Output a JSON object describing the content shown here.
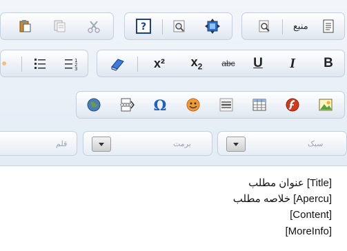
{
  "toolbar": {
    "source_label": "منبع",
    "superscript": "x²",
    "subscript_base": "x",
    "subscript_index": "2",
    "strike": "abc",
    "underline": "U",
    "italic": "I",
    "bold": "B"
  },
  "combos": {
    "style_placeholder": "سبک",
    "format_placeholder": "برمت",
    "font_placeholder": "قلم"
  },
  "content": {
    "lines": [
      "عنوان مطلب [Title]",
      "خلاصه مطلب [Apercu]",
      "[Content]",
      "[MoreInfo]"
    ]
  },
  "colors": {
    "toolbar_bg": "#e3ebf5",
    "icon_blue": "#1f5fbf",
    "flash_red": "#d23a1a"
  }
}
